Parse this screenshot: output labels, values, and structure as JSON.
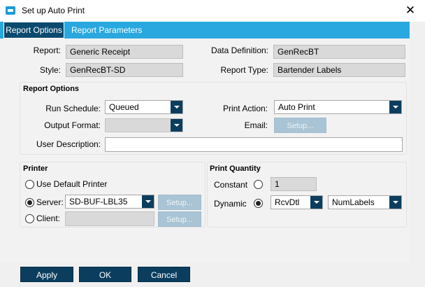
{
  "window": {
    "title": "Set up Auto Print",
    "app_icon": "app-icon",
    "close_glyph": "✕"
  },
  "tabs": [
    {
      "label": "Report Options",
      "active": true
    },
    {
      "label": "Report Parameters",
      "active": false
    }
  ],
  "report": {
    "report_label": "Report:",
    "report_value": "Generic Receipt",
    "style_label": "Style:",
    "style_value": "GenRecBT-SD",
    "data_definition_label": "Data Definition:",
    "data_definition_value": "GenRecBT",
    "report_type_label": "Report Type:",
    "report_type_value": "Bartender Labels"
  },
  "report_options": {
    "title": "Report Options",
    "run_schedule_label": "Run Schedule:",
    "run_schedule_value": "Queued",
    "output_format_label": "Output Format:",
    "output_format_value": "",
    "print_action_label": "Print Action:",
    "print_action_value": "Auto Print",
    "email_label": "Email:",
    "email_setup_label": "Setup...",
    "user_description_label": "User Description:",
    "user_description_value": ""
  },
  "printer": {
    "title": "Printer",
    "use_default_label": "Use Default Printer",
    "server_label": "Server:",
    "server_value": "SD-BUF-LBL35",
    "server_setup_label": "Setup...",
    "client_label": "Client:",
    "client_value": "",
    "client_setup_label": "Setup...",
    "selected": "server"
  },
  "print_quantity": {
    "title": "Print Quantity",
    "constant_label": "Constant",
    "constant_value": "1",
    "dynamic_label": "Dynamic",
    "dynamic_table_value": "RcvDtl",
    "dynamic_field_value": "NumLabels",
    "selected": "dynamic"
  },
  "footer": {
    "apply_label": "Apply",
    "ok_label": "OK",
    "cancel_label": "Cancel"
  },
  "colors": {
    "accent_tab_bar": "#29a8df",
    "active_tab": "#0b4a6e",
    "button": "#0b3e5e",
    "disabled_button": "#a9c4d4"
  }
}
